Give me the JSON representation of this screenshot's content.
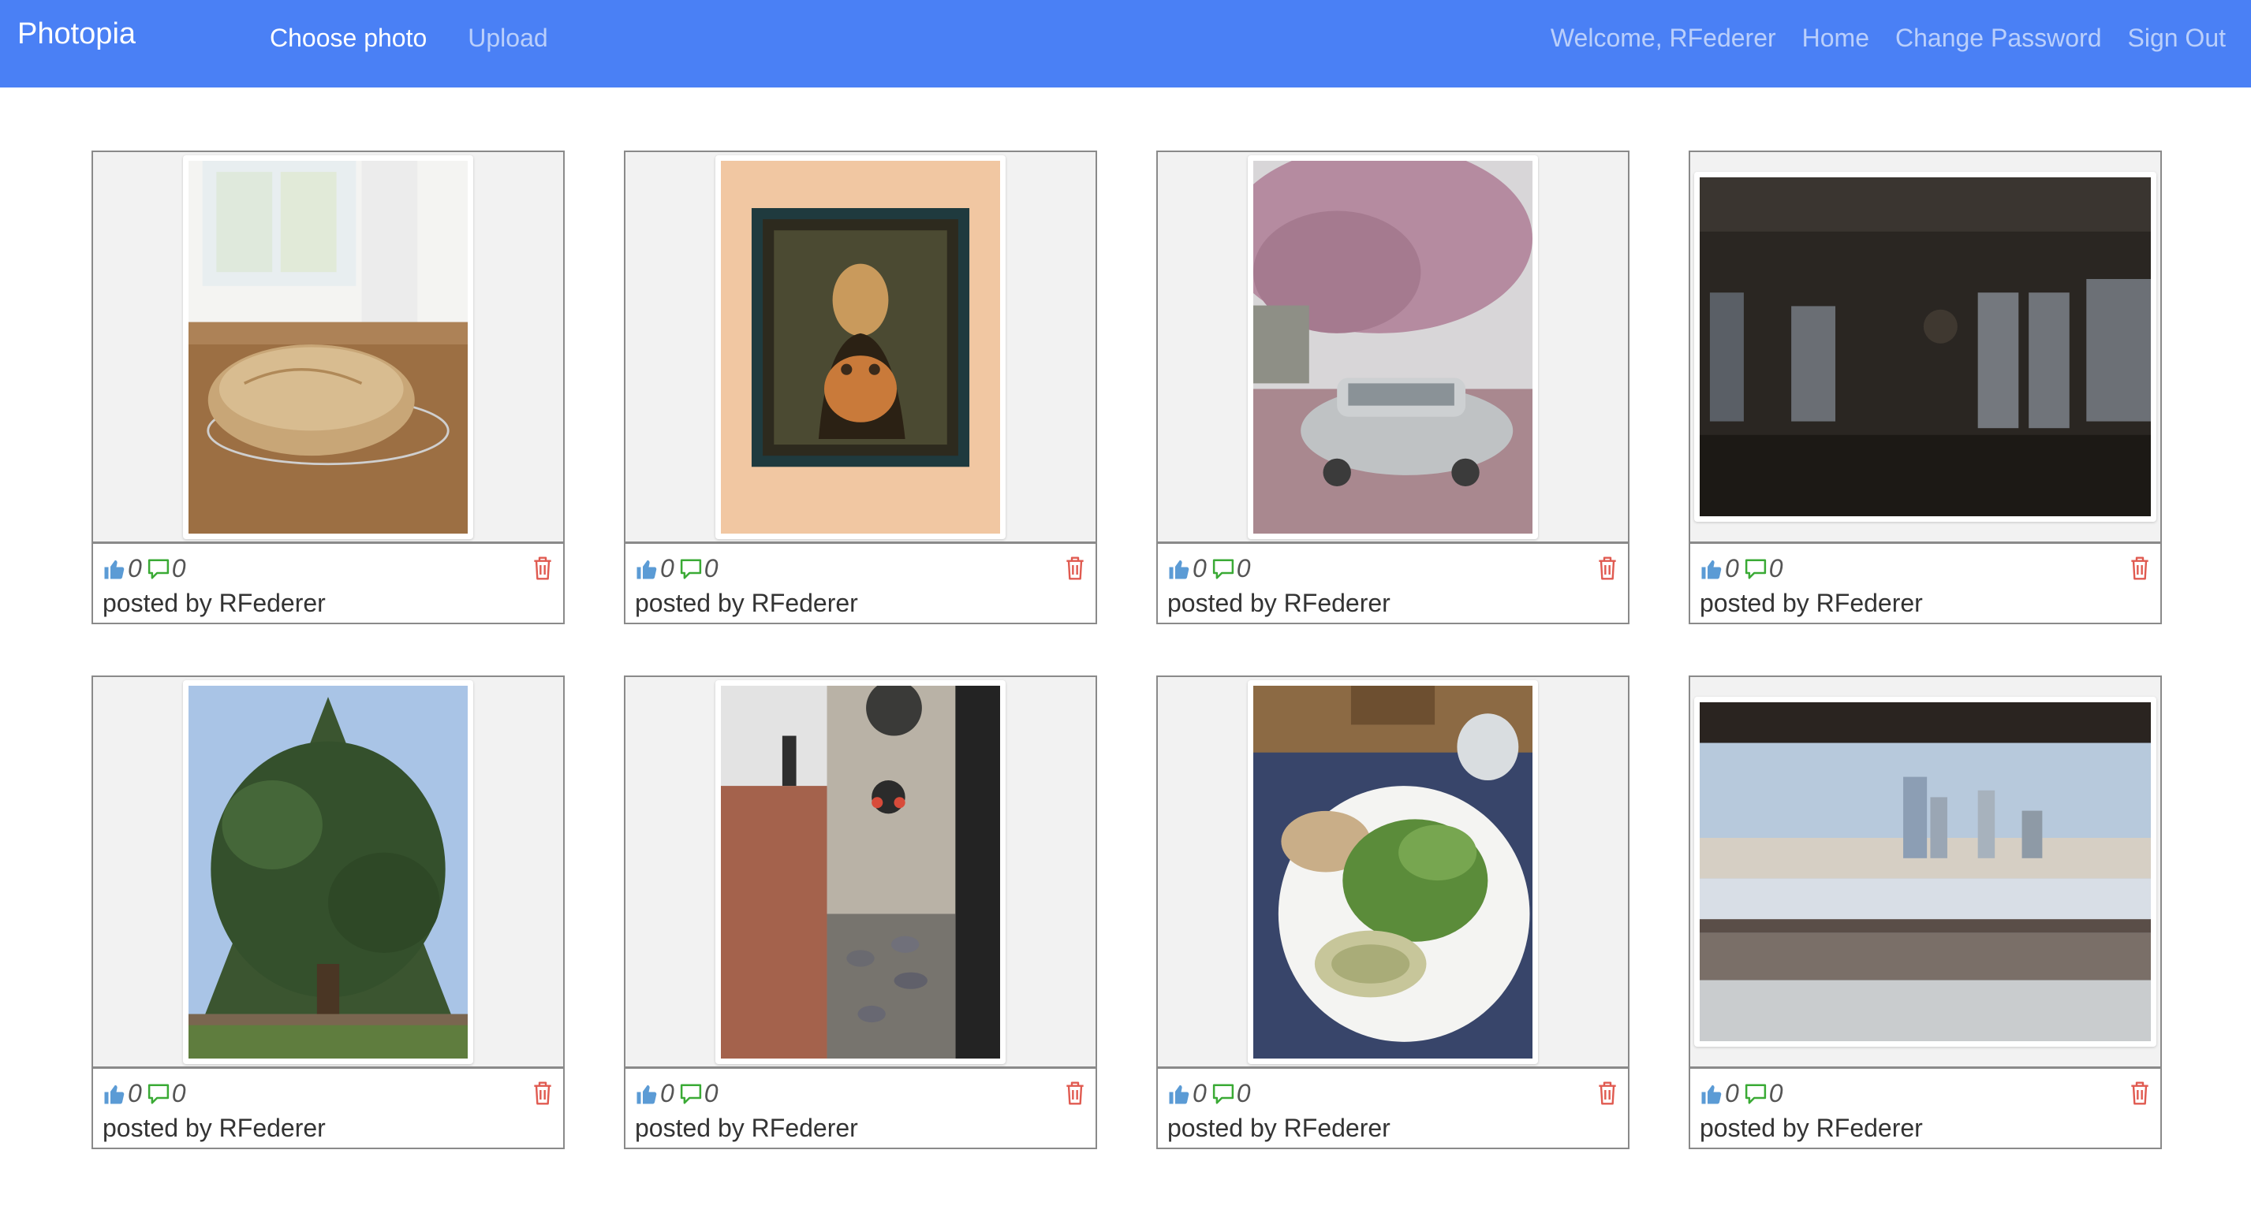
{
  "navbar": {
    "brand": "Photopia",
    "left_links": [
      "Choose photo",
      "Upload"
    ],
    "welcome": "Welcome, RFederer",
    "right_links": [
      "Home",
      "Change Password",
      "Sign Out"
    ],
    "background_color": "#4a80f5"
  },
  "icons": {
    "like": "thumbs-up-icon",
    "comment": "comment-icon",
    "delete": "trash-icon"
  },
  "colors": {
    "like_icon": "#5b9bd5",
    "comment_icon": "#3aaa35",
    "delete_icon": "#e05a50"
  },
  "photos": [
    {
      "subject": "bread",
      "likes": "0",
      "comments": "0",
      "poster": "posted by RFederer"
    },
    {
      "subject": "painting",
      "likes": "0",
      "comments": "0",
      "poster": "posted by RFederer"
    },
    {
      "subject": "car-blossoms",
      "likes": "0",
      "comments": "0",
      "poster": "posted by RFederer"
    },
    {
      "subject": "night-windows",
      "likes": "0",
      "comments": "0",
      "poster": "posted by RFederer"
    },
    {
      "subject": "tree",
      "likes": "0",
      "comments": "0",
      "poster": "posted by RFederer"
    },
    {
      "subject": "pigeons",
      "likes": "0",
      "comments": "0",
      "poster": "posted by RFederer"
    },
    {
      "subject": "salad",
      "likes": "0",
      "comments": "0",
      "poster": "posted by RFederer"
    },
    {
      "subject": "skyline",
      "likes": "0",
      "comments": "0",
      "poster": "posted by RFederer"
    }
  ]
}
